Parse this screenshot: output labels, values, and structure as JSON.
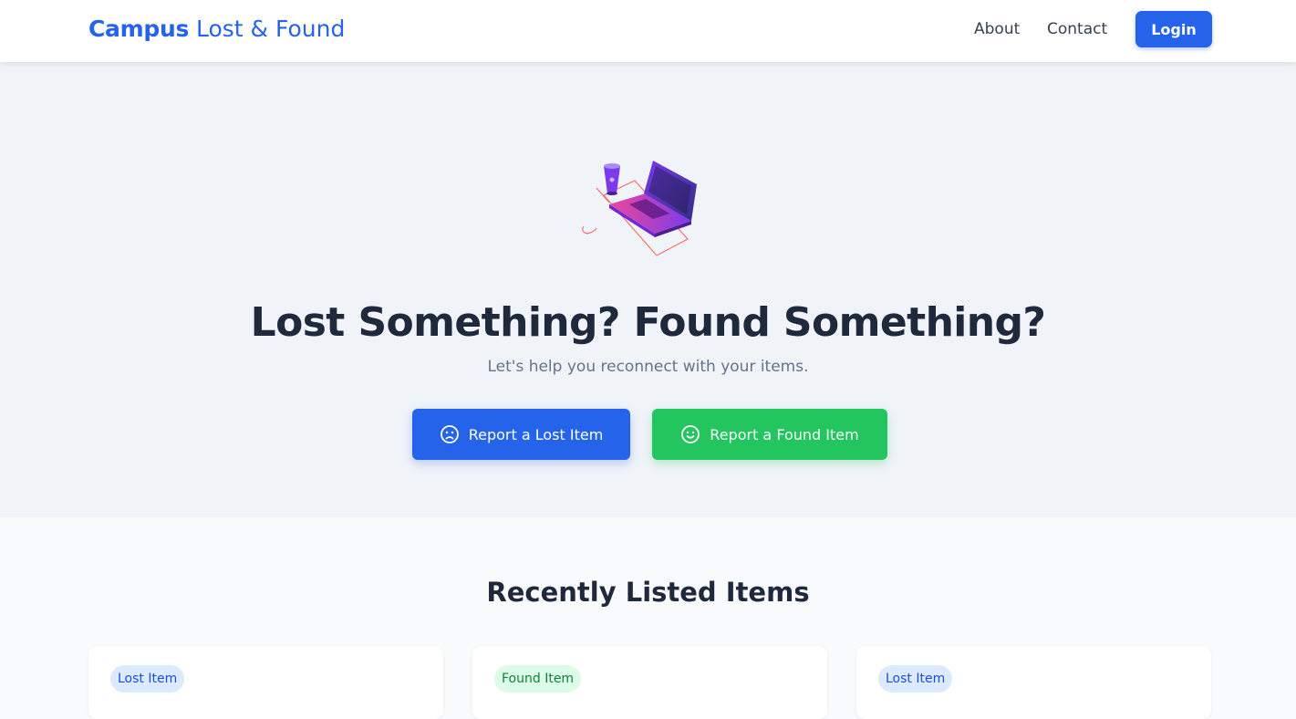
{
  "nav": {
    "brand_strong": "Campus",
    "brand_light": "Lost & Found",
    "links": [
      "About",
      "Contact"
    ],
    "login_label": "Login"
  },
  "hero": {
    "illustration_icon": "laptop-and-cup-illustration",
    "title": "Lost Something? Found Something?",
    "subtitle": "Let's help you reconnect with your items.",
    "buttons": [
      {
        "label": "Report a Lost Item",
        "icon": "sad-face-icon"
      },
      {
        "label": "Report a Found Item",
        "icon": "smile-face-icon"
      }
    ]
  },
  "recent": {
    "title": "Recently Listed Items",
    "items": [
      {
        "badge": "Lost Item"
      },
      {
        "badge": "Found Item"
      },
      {
        "badge": "Lost Item"
      }
    ]
  },
  "colors": {
    "primary": "#2563eb",
    "success": "#22c55e",
    "hero_bg": "#f0f3f8",
    "heading": "#1e293b"
  }
}
